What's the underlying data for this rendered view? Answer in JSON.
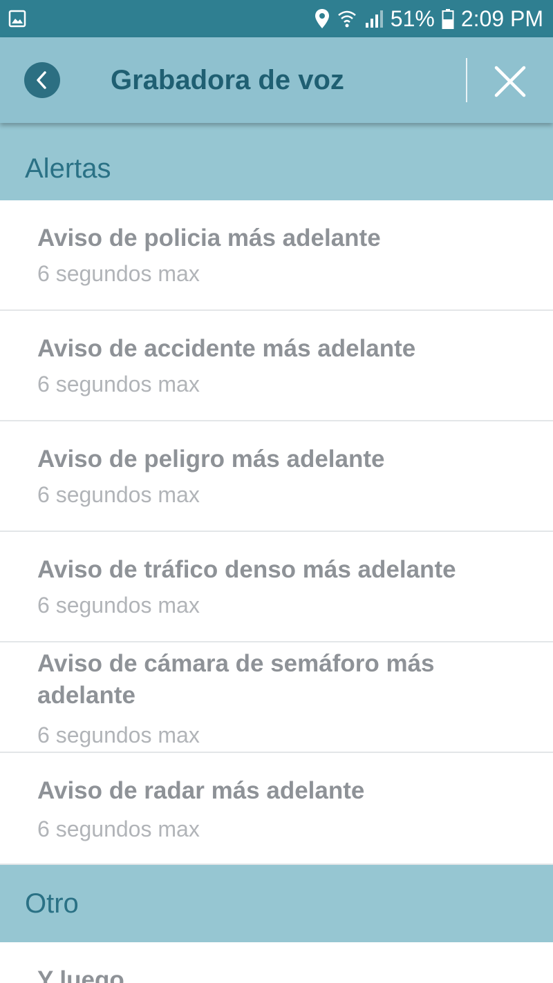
{
  "status_bar": {
    "battery": "51%",
    "time": "2:09 PM",
    "icons": [
      "image-icon",
      "location-icon",
      "wifi-icon",
      "signal-icon",
      "battery-icon"
    ]
  },
  "app_bar": {
    "title": "Grabadora de voz",
    "back_icon": "chevron-left-icon",
    "close_icon": "close-icon"
  },
  "sections": [
    {
      "header": "Alertas",
      "items": [
        {
          "title": "Aviso de policia más adelante",
          "subtitle": "6 segundos max"
        },
        {
          "title": "Aviso de accidente más adelante",
          "subtitle": "6 segundos max"
        },
        {
          "title": "Aviso de peligro más adelante",
          "subtitle": "6 segundos max"
        },
        {
          "title": "Aviso de tráfico denso más adelante",
          "subtitle": "6 segundos max"
        },
        {
          "title": "Aviso de cámara de semáforo más adelante",
          "subtitle": "6 segundos max"
        },
        {
          "title": "Aviso de radar más adelante",
          "subtitle": "6 segundos max"
        }
      ]
    },
    {
      "header": "Otro",
      "items": [
        {
          "title": "Y luego"
        }
      ]
    }
  ],
  "colors": {
    "status_bar": "#2f7f91",
    "app_bar": "#8fc1cf",
    "section_header": "#96c6d2",
    "title_text": "#1f5f72",
    "item_title": "#8e9297",
    "item_subtitle": "#b1b4b8"
  }
}
